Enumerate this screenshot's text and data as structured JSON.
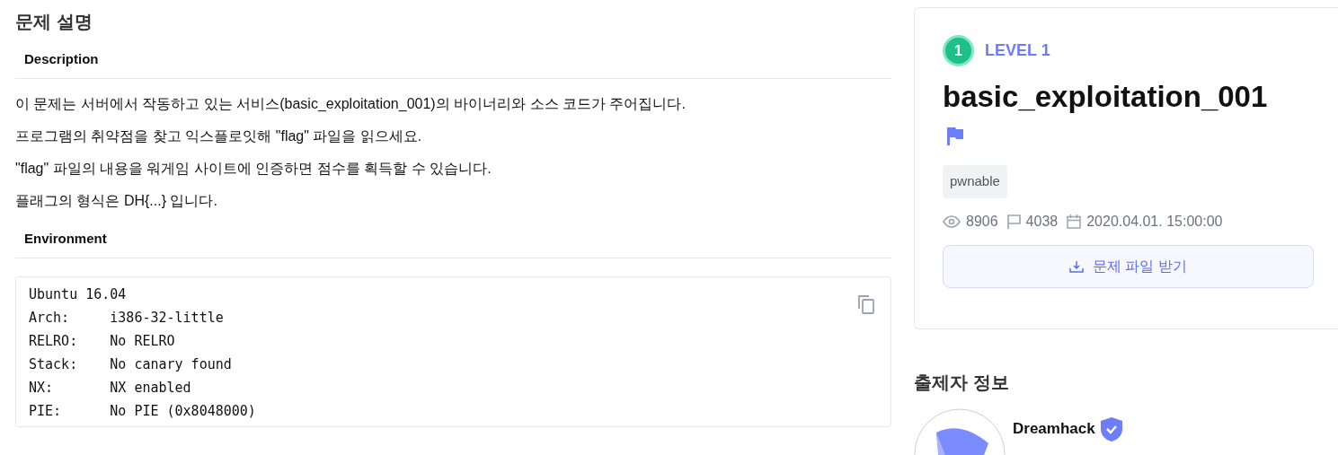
{
  "main": {
    "title": "문제 설명",
    "sections": [
      {
        "heading": "Description",
        "kind": "text",
        "lines": [
          "이 문제는 서버에서 작동하고 있는 서비스(basic_exploitation_001)의 바이너리와 소스 코드가 주어집니다.",
          "프로그램의 취약점을 찾고 익스플로잇해 \"flag\" 파일을 읽으세요.",
          "\"flag\" 파일의 내용을 워게임 사이트에 인증하면 점수를 획득할 수 있습니다.",
          "플래그의 형식은 DH{...} 입니다."
        ]
      },
      {
        "heading": "Environment",
        "kind": "code",
        "lines": [
          "Ubuntu 16.04",
          "Arch:     i386-32-little",
          "RELRO:    No RELRO",
          "Stack:    No canary found",
          "NX:       NX enabled",
          "PIE:      No PIE (0x8048000)"
        ]
      }
    ]
  },
  "challenge": {
    "level_number": "1",
    "level_label": "LEVEL 1",
    "title": "basic_exploitation_001",
    "tags": [
      "pwnable"
    ],
    "views": "8906",
    "solves": "4038",
    "date": "2020.04.01. 15:00:00",
    "download_button": "문제 파일 받기"
  },
  "author": {
    "heading": "출제자 정보",
    "name": "Dreamhack",
    "verified": true
  }
}
